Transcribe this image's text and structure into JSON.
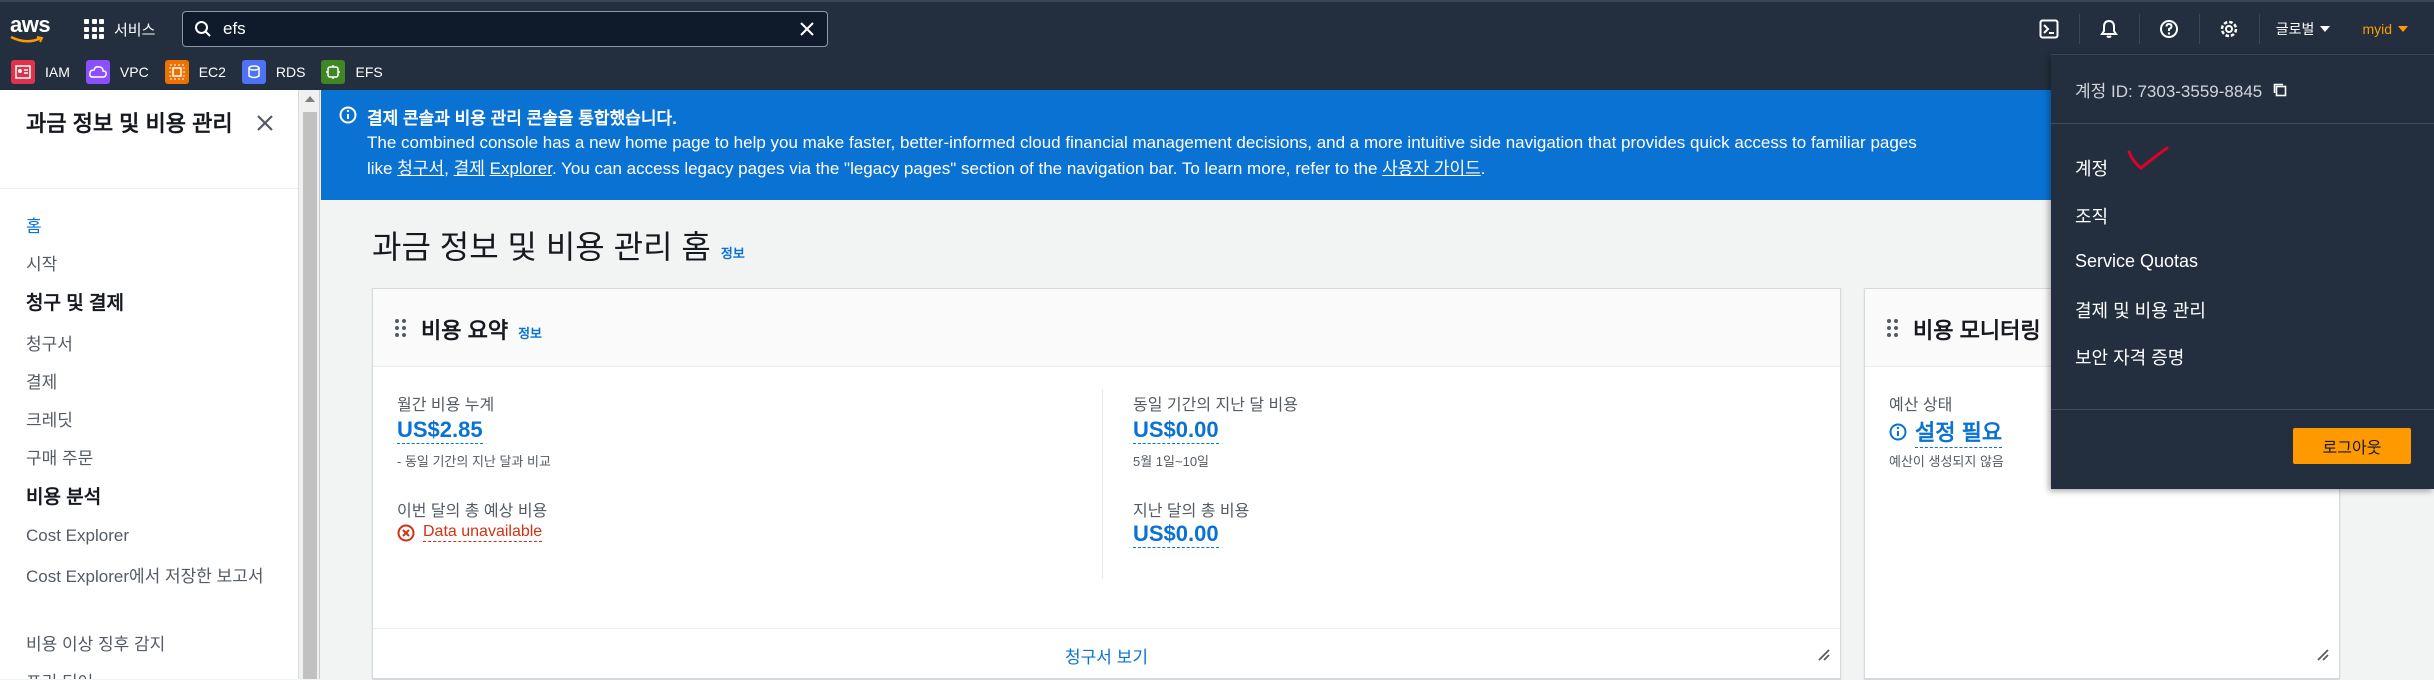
{
  "topbar": {
    "logo_text": "aws",
    "services_label": "서비스",
    "search_value": "efs",
    "region_label": "글로벌",
    "account_label": "myid"
  },
  "favorites": [
    {
      "label": "IAM",
      "color": "#dd344c"
    },
    {
      "label": "VPC",
      "color": "#8c4fff"
    },
    {
      "label": "EC2",
      "color": "#ed7100"
    },
    {
      "label": "RDS",
      "color": "#4d72f3"
    },
    {
      "label": "EFS",
      "color": "#3f8624"
    }
  ],
  "sidenav": {
    "title": "과금 정보 및 비용 관리",
    "items": {
      "home": "홈",
      "getting_started": "시작",
      "section_billing": "청구 및 결제",
      "bills": "청구서",
      "payments": "결제",
      "credits": "크레딧",
      "purchase_orders": "구매 주문",
      "section_cost_analysis": "비용 분석",
      "cost_explorer": "Cost Explorer",
      "saved_reports": "Cost Explorer에서 저장한 보고서",
      "anomaly_detection": "비용 이상 징후 감지",
      "free_tier": "프리 티어"
    }
  },
  "banner": {
    "title": "결제 콘솔과 비용 관리 콘솔을 통합했습니다.",
    "body_1": "The combined console has a new home page to help you make faster, better-informed cloud financial management decisions, and a more intuitive side navigation that provides quick access to familiar pages like ",
    "link_bills": "청구서",
    "sep": ", ",
    "link_payments": "결제",
    "link_explorer": "Explorer",
    "body_2": ". You can access legacy pages via the \"legacy pages\" section of the navigation bar. To learn more, refer to the ",
    "link_guide": "사용자 가이드",
    "body_3": "."
  },
  "page": {
    "title": "과금 정보 및 비용 관리 홈",
    "info": "정보"
  },
  "cost_summary": {
    "title": "비용 요약",
    "info": "정보",
    "mtd_label": "월간 비용 누계",
    "mtd_value": "US$2.85",
    "mtd_sub": "- 동일 기간의 지난 달과 비교",
    "last_month_same_period_label": "동일 기간의 지난 달 비용",
    "last_month_same_period_value": "US$0.00",
    "last_month_same_period_sub": "5월 1일~10일",
    "forecast_label": "이번 달의 총 예상 비용",
    "forecast_error": "Data unavailable",
    "last_month_total_label": "지난 달의 총 비용",
    "last_month_total_value": "US$0.00",
    "footer_link": "청구서 보기"
  },
  "cost_monitor": {
    "title": "비용 모니터링",
    "budget_label": "예산 상태",
    "budget_value": "설정 필요",
    "budget_sub": "예산이 생성되지 않음"
  },
  "account_menu": {
    "account_id": "계정 ID: 7303-3559-8845",
    "items": [
      "계정",
      "조직",
      "Service Quotas",
      "결제 및 비용 관리",
      "보안 자격 증명"
    ],
    "logout": "로그아웃"
  }
}
